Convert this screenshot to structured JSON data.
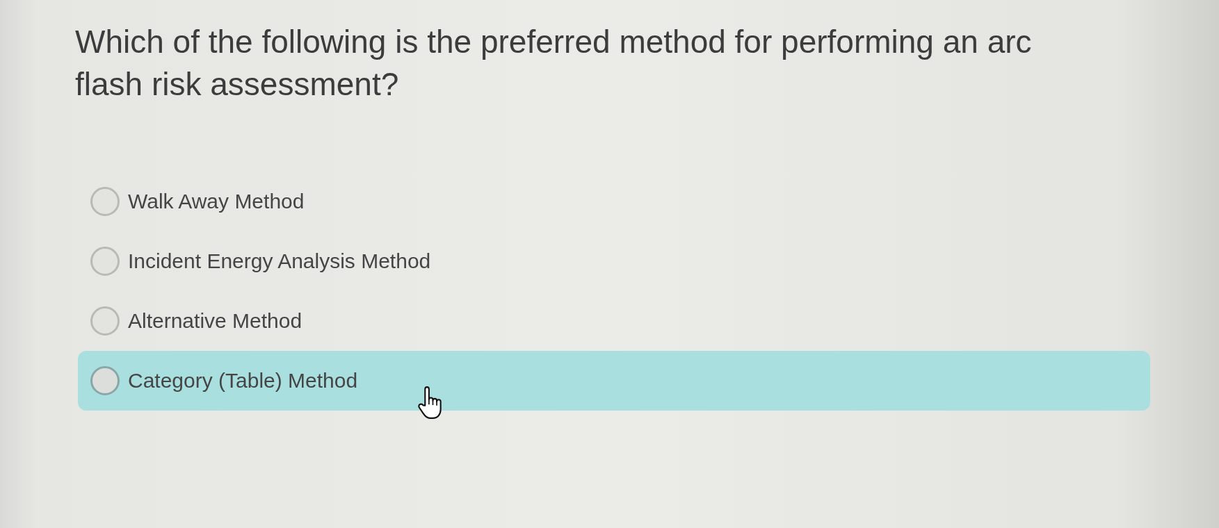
{
  "question": {
    "text": "Which of the following is the preferred method for performing an arc flash risk assessment?"
  },
  "options": [
    {
      "label": "Walk Away Method",
      "selected": false,
      "highlighted": false
    },
    {
      "label": "Incident Energy Analysis Method",
      "selected": false,
      "highlighted": false
    },
    {
      "label": "Alternative Method",
      "selected": false,
      "highlighted": false
    },
    {
      "label": "Category (Table) Method",
      "selected": false,
      "highlighted": true
    }
  ]
}
